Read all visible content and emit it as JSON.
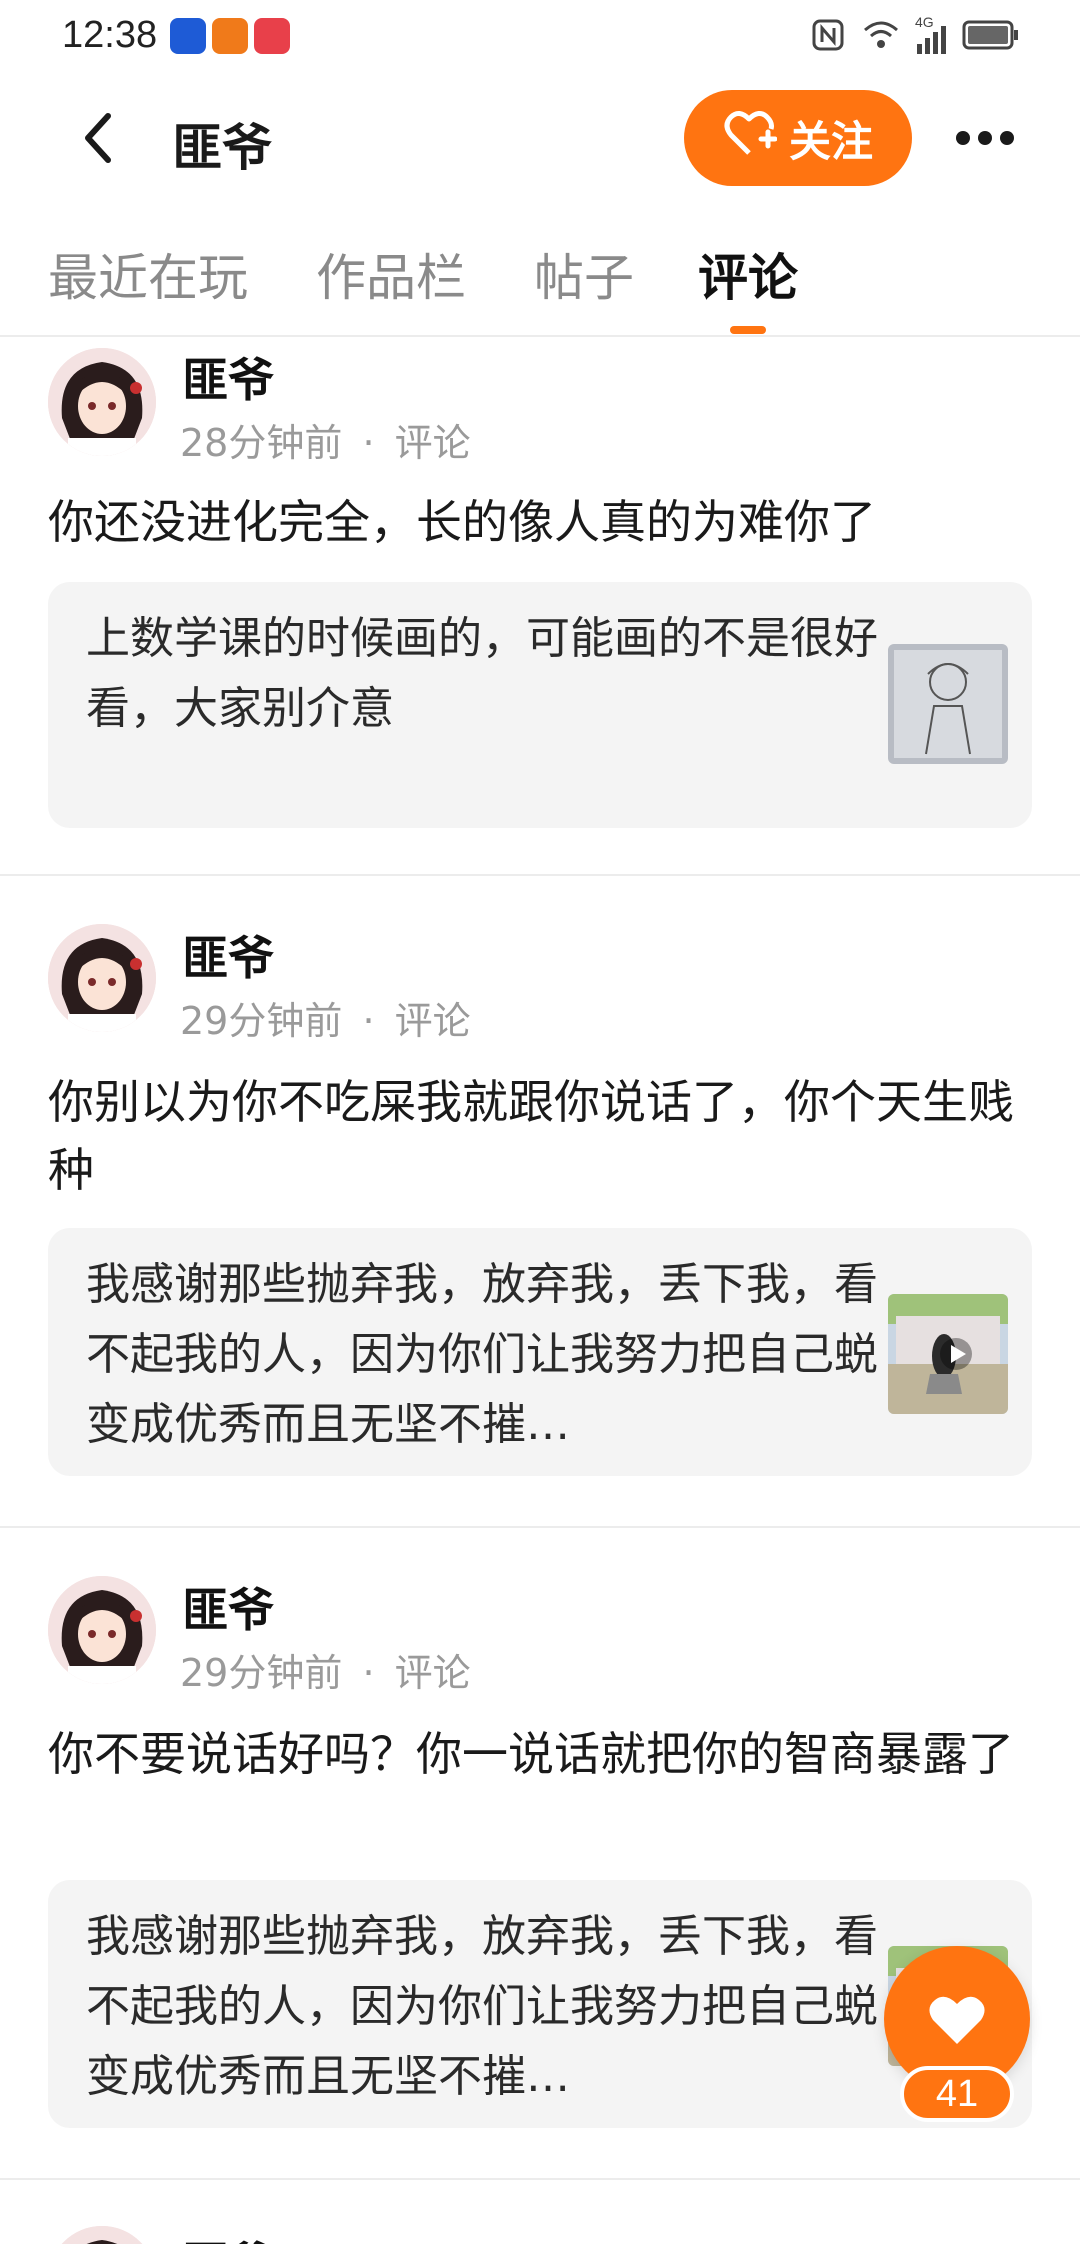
{
  "status_bar": {
    "time": "12:38",
    "network_label": "4G"
  },
  "header": {
    "title": "匪爷",
    "follow_label": "关注"
  },
  "tabs": [
    {
      "label": "最近在玩"
    },
    {
      "label": "作品栏"
    },
    {
      "label": "帖子"
    },
    {
      "label": "评论"
    }
  ],
  "posts": [
    {
      "author": "匪爷",
      "time": "28分钟前",
      "type": "评论",
      "text": "你还没进化完全，长的像人真的为难你了",
      "quote": "上数学课的时候画的，可能画的不是很好看，大家别介意"
    },
    {
      "author": "匪爷",
      "time": "29分钟前",
      "type": "评论",
      "text": "你别以为你不吃屎我就跟你说话了，你个天生贱种",
      "quote": "我感谢那些抛弃我，放弃我，丢下我，看不起我的人，因为你们让我努力把自己蜕变成优秀而且无坚不摧…"
    },
    {
      "author": "匪爷",
      "time": "29分钟前",
      "type": "评论",
      "text": "你不要说话好吗？你一说话就把你的智商暴露了",
      "quote": "我感谢那些抛弃我，放弃我，丢下我，看不起我的人，因为你们让我努力把自己蜕变成优秀而且无坚不摧…"
    },
    {
      "author": "匪爷"
    }
  ],
  "meta_separator": "·",
  "like": {
    "count": "41"
  },
  "colors": {
    "accent": "#ff7411"
  }
}
